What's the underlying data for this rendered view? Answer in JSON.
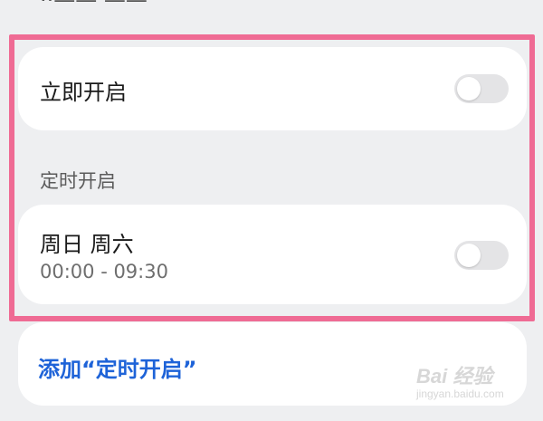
{
  "header": {
    "cut_text": "··—— ——"
  },
  "instant": {
    "label": "立即开启",
    "enabled": false
  },
  "schedule_section": {
    "title": "定时开启"
  },
  "schedule_item": {
    "days": "周日 周六",
    "time": "00:00 - 09:30",
    "enabled": false
  },
  "add": {
    "label": "添加“定时开启”"
  },
  "watermark": {
    "logo": "Bai  经验",
    "sub": "jingyan.baidu.com"
  },
  "colors": {
    "highlight": "#ef6b94",
    "link": "#1e63d8",
    "toggle_off": "#e4e4e6"
  }
}
